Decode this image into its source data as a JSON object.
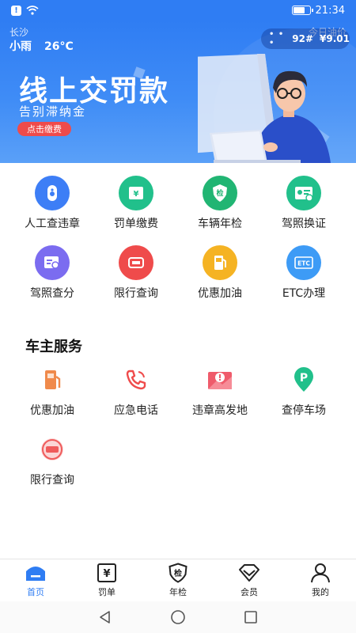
{
  "status_bar": {
    "time": "21:34"
  },
  "header": {
    "city": "长沙",
    "weather": "小雨",
    "temperature": "26°C",
    "oil_label": "今日油价",
    "oil_grade": "92#",
    "oil_price": "¥9.01"
  },
  "banner": {
    "headline": "线上交罚款",
    "subline": "告别滞纳金",
    "button_label": "点击缴费"
  },
  "quick_actions": [
    {
      "label": "人工查违章",
      "icon": "capsule-search-icon",
      "color": "#3d7ef6"
    },
    {
      "label": "罚单缴费",
      "icon": "fine-ticket-icon",
      "color": "#21c08b"
    },
    {
      "label": "车辆年检",
      "icon": "inspection-shield-icon",
      "color": "#21b573"
    },
    {
      "label": "驾照换证",
      "icon": "license-renew-icon",
      "color": "#21c08b"
    },
    {
      "label": "驾照查分",
      "icon": "license-score-icon",
      "color": "#7b6cf0"
    },
    {
      "label": "限行查询",
      "icon": "restriction-icon",
      "color": "#ef4b4b"
    },
    {
      "label": "优惠加油",
      "icon": "fuel-pump-icon",
      "color": "#f5b323"
    },
    {
      "label": "ETC办理",
      "icon": "etc-card-icon",
      "color": "#3d9bf6"
    }
  ],
  "owner_services": {
    "title": "车主服务",
    "items": [
      {
        "label": "优惠加油",
        "icon": "fuel-station-icon",
        "color": "#f08a4b"
      },
      {
        "label": "应急电话",
        "icon": "phone-icon",
        "color": "#ef4b4b"
      },
      {
        "label": "违章高发地",
        "icon": "warning-map-icon",
        "color": "#ef5b6b"
      },
      {
        "label": "查停车场",
        "icon": "parking-pin-icon",
        "color": "#21c08b"
      },
      {
        "label": "限行查询",
        "icon": "restriction-icon",
        "color": "#ef5b5b"
      }
    ]
  },
  "tabs": [
    {
      "label": "首页",
      "icon": "home-icon",
      "active": true
    },
    {
      "label": "罚单",
      "icon": "fine-yen-icon",
      "active": false
    },
    {
      "label": "年检",
      "icon": "inspection-icon",
      "active": false
    },
    {
      "label": "会员",
      "icon": "vip-diamond-icon",
      "active": false
    },
    {
      "label": "我的",
      "icon": "profile-icon",
      "active": false
    }
  ],
  "glyphs": {
    "yen": "¥",
    "inspect": "检",
    "etc": "ETC"
  }
}
